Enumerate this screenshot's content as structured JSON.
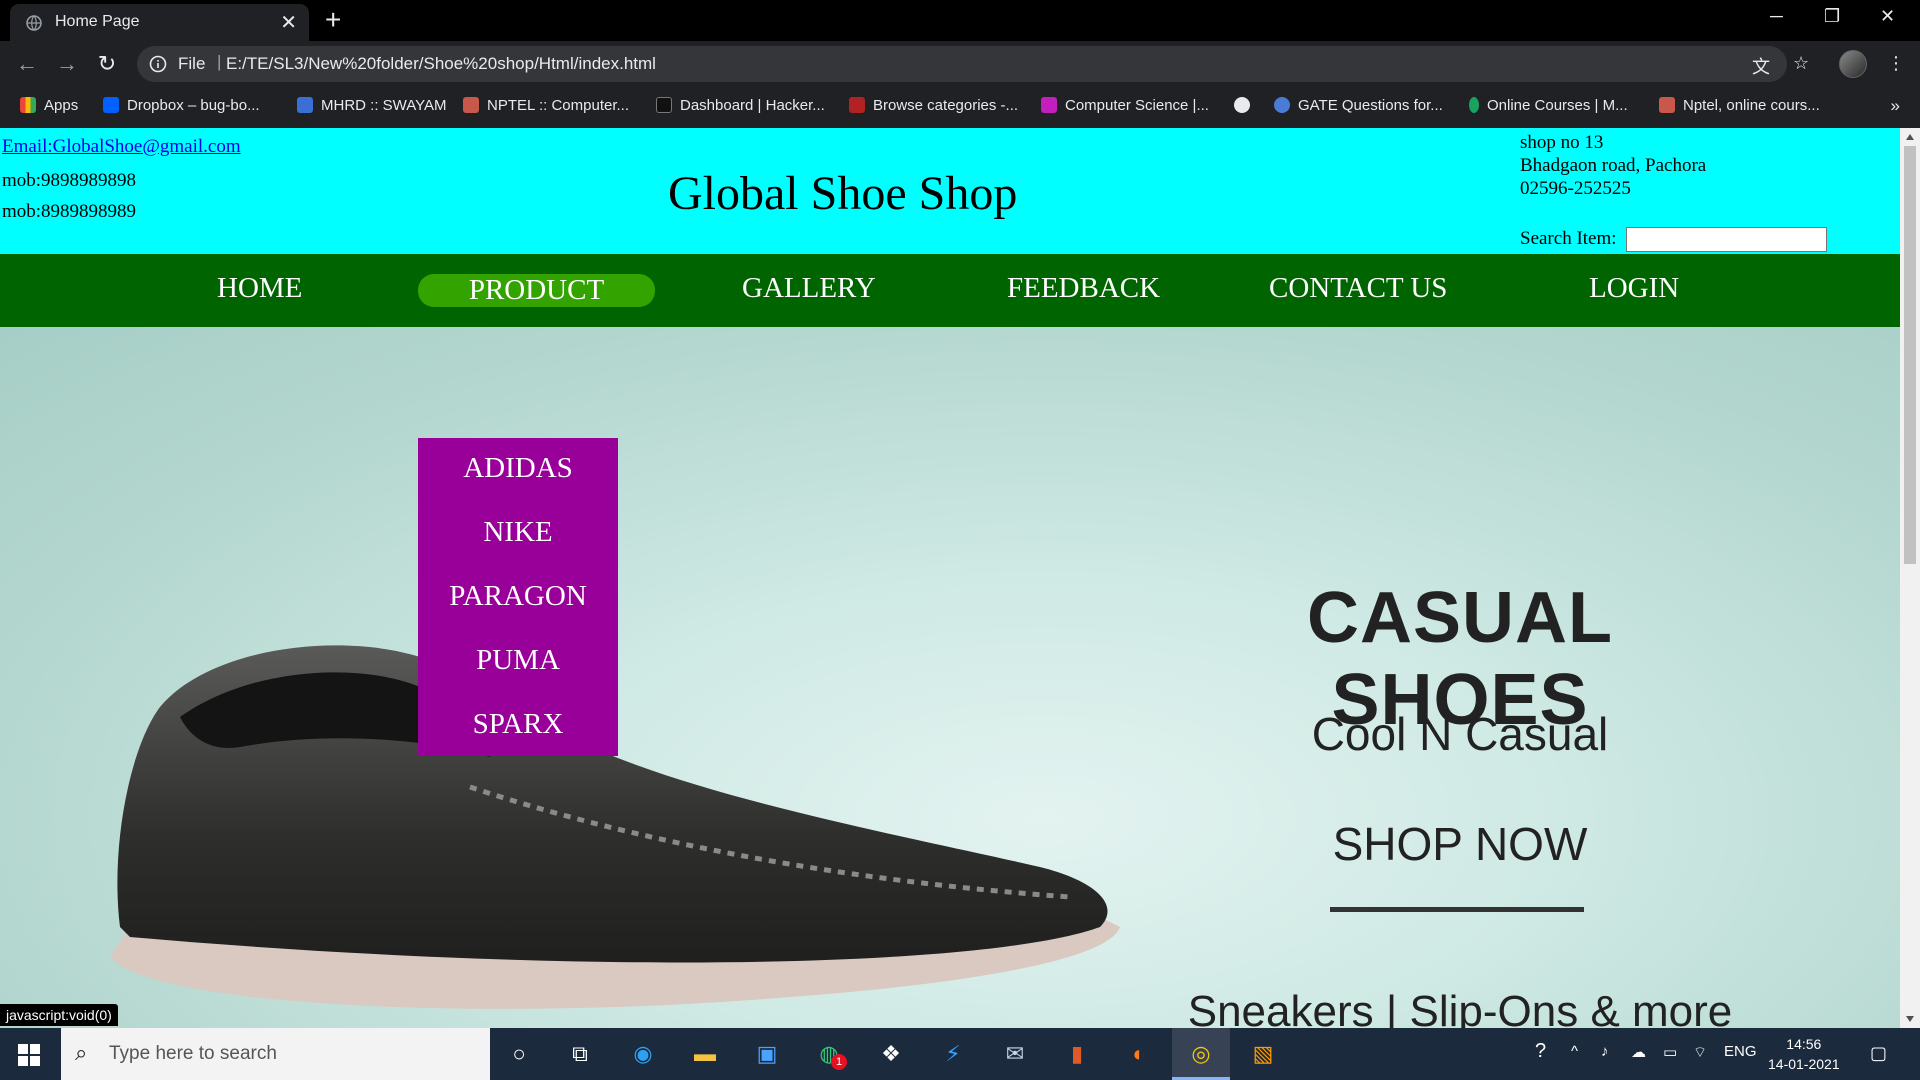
{
  "browser": {
    "tab_title": "Home Page",
    "new_tab": "+",
    "tab_close": "✕",
    "window_controls": {
      "minimize": "─",
      "restore": "❐",
      "close": "✕"
    },
    "omnibox": {
      "scheme": "File",
      "separator": "|",
      "url": "E:/TE/SL3/New%20folder/Shoe%20shop/Html/index.html"
    },
    "bookmarks": [
      {
        "label": "Apps",
        "color": "#e8453c"
      },
      {
        "label": "Dropbox – bug-bo...",
        "color": "#0061ff"
      },
      {
        "label": "MHRD :: SWAYAM",
        "color": "#3b6fd6"
      },
      {
        "label": "NPTEL :: Computer...",
        "color": "#c8584a"
      },
      {
        "label": "Dashboard | Hacker...",
        "color": "#111111"
      },
      {
        "label": "Browse categories -...",
        "color": "#b22222"
      },
      {
        "label": "Computer Science |...",
        "color": "#c21fbd"
      },
      {
        "label": "",
        "color": "#e8eaed"
      },
      {
        "label": "GATE Questions for...",
        "color": "#4a7bd6"
      },
      {
        "label": "Online Courses | M...",
        "color": "#1aa260"
      },
      {
        "label": "Nptel, online cours...",
        "color": "#c8584a"
      }
    ],
    "bookmarks_more": "»"
  },
  "site": {
    "email": "Email:GlobalShoe@gmail.com",
    "mob1": "mob:9898989898",
    "mob2": "mob:8989898989",
    "title": "Global Shoe Shop",
    "address": [
      "shop no 13",
      "Bhadgaon road, Pachora",
      "02596-252525"
    ],
    "search_label": "Search Item:",
    "search_value": "",
    "nav": [
      "HOME",
      "PRODUCT",
      "GALLERY",
      "FEEDBACK",
      "CONTACT US",
      "LOGIN"
    ],
    "active_nav": "PRODUCT",
    "dropdown": [
      "ADIDAS",
      "NIKE",
      "PARAGON",
      "PUMA",
      "SPARX"
    ],
    "hero": {
      "headline": "CASUAL SHOES",
      "tagline": "Cool N Casual",
      "cta": "SHOP NOW",
      "footer": "Sneakers | Slip-Ons & more"
    },
    "colors": {
      "header_bg": "#00ffff",
      "nav_bg": "#006400",
      "nav_active": "#33a300",
      "dropdown_bg": "#990099"
    }
  },
  "status_bar": "javascript:void(0)",
  "taskbar": {
    "search_placeholder": "Type here to search",
    "language": "ENG",
    "time": "14:56",
    "date": "14-01-2021",
    "badge_count": "1"
  }
}
